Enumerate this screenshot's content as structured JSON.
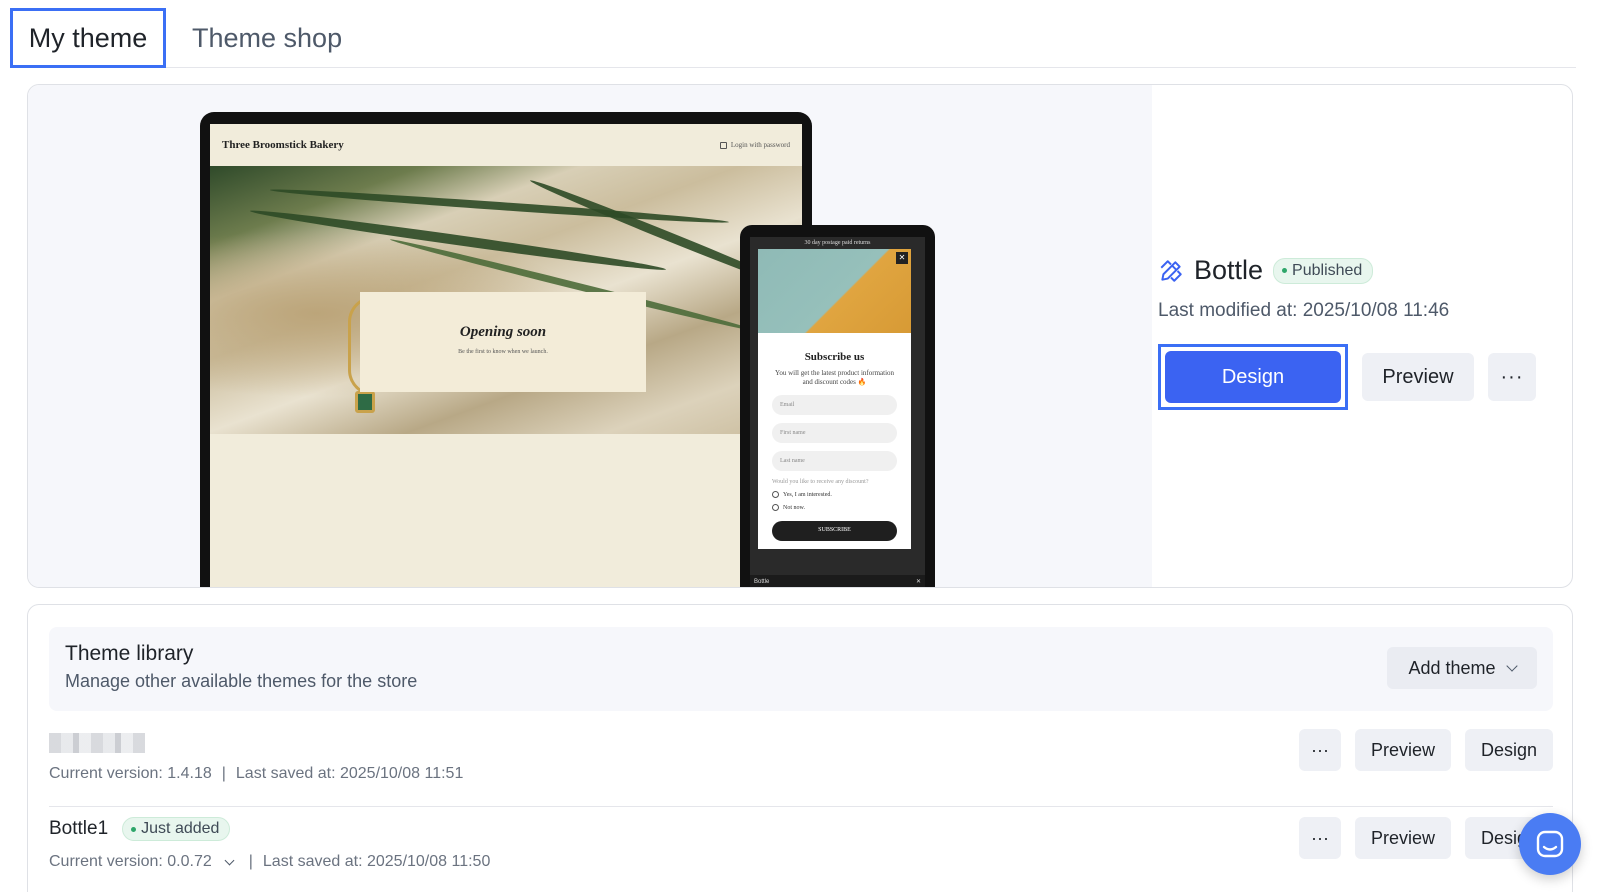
{
  "tabs": {
    "my_theme": "My theme",
    "theme_shop": "Theme shop"
  },
  "current_theme": {
    "name": "Bottle",
    "status": "Published",
    "modified_label": "Last modified at:",
    "modified_value": "2025/10/08 11:46",
    "design_label": "Design",
    "preview_label": "Preview",
    "more_label": "···"
  },
  "tablet_preview": {
    "brand": "Three Broomstick Bakery",
    "login": "Login with password",
    "title": "Opening soon",
    "subtitle": "Be the first to know when we launch."
  },
  "phone_preview": {
    "topbar": "30 day postage paid returns",
    "title": "Subscribe us",
    "subtitle": "You will get the latest product information and discount codes 🔥",
    "email": "Email",
    "first_name": "First name",
    "last_name": "Last name",
    "question": "Would you like to receive any discount?",
    "option_yes": "Yes, I am interested.",
    "option_no": "Not now.",
    "subscribe": "SUBSCRIBE",
    "bottom_label": "Bottle",
    "close": "✕"
  },
  "library": {
    "title": "Theme library",
    "subtitle": "Manage other available themes for the store",
    "add_theme": "Add theme",
    "rows": [
      {
        "name": "",
        "version": "Current version: 1.4.18",
        "saved": "Last saved at: 2025/10/08 11:51",
        "more": "···",
        "preview": "Preview",
        "design": "Design"
      },
      {
        "name": "Bottle1",
        "badge": "Just added",
        "version": "Current version: 0.0.72",
        "saved": "Last saved at: 2025/10/08 11:50",
        "more": "···",
        "preview": "Preview",
        "design": "Design"
      }
    ]
  },
  "colors": {
    "accent": "#3b63f2",
    "focus_outline": "#3b6ff5",
    "success": "#2ea66a"
  },
  "icons": {
    "theme": "brush-icon",
    "chat": "chat-icon"
  }
}
